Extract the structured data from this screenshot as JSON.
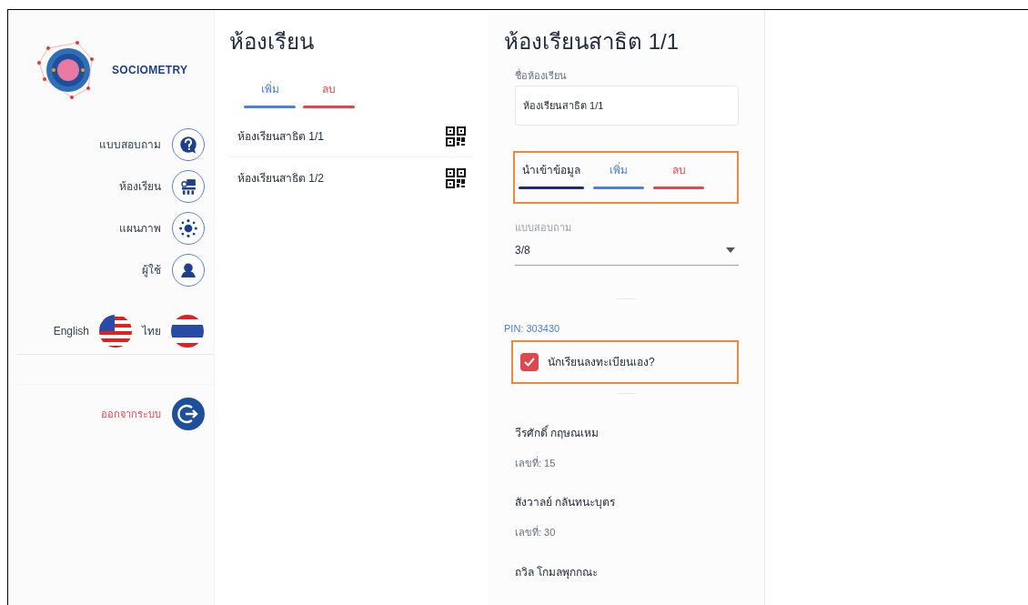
{
  "brand": {
    "name": "SOCIOMETRY"
  },
  "nav": [
    {
      "label": "แบบสอบถาม",
      "kind": "questionnaire"
    },
    {
      "label": "ห้องเรียน",
      "kind": "classroom"
    },
    {
      "label": "แผนภาพ",
      "kind": "diagram"
    },
    {
      "label": "ผู้ใช้",
      "kind": "user"
    }
  ],
  "languages": [
    {
      "label": "English",
      "kind": "us"
    },
    {
      "label": "ไทย",
      "kind": "th"
    }
  ],
  "logout": {
    "label": "ออกจากระบบ"
  },
  "classrooms": {
    "title": "ห้องเรียน",
    "actions": [
      {
        "label": "เพิ่ม",
        "kind": "add"
      },
      {
        "label": "ลบ",
        "kind": "delete"
      }
    ],
    "items": [
      {
        "name": "ห้องเรียนสาธิต 1/1"
      },
      {
        "name": "ห้องเรียนสาธิต 1/2"
      }
    ]
  },
  "detail": {
    "title": "ห้องเรียนสาธิต 1/1",
    "name_field": {
      "label": "ชื่อห้องเรียน",
      "value": "ห้องเรียนสาธิต 1/1"
    },
    "actions_highlighted": true,
    "actions": [
      {
        "label": "นำเข้าข้อมูล",
        "kind": "import"
      },
      {
        "label": "เพิ่ม",
        "kind": "add"
      },
      {
        "label": "ลบ",
        "kind": "delete"
      }
    ],
    "questionnaire": {
      "label": "แบบสอบถาม",
      "value": "3/8"
    },
    "pin": "PIN: 303430",
    "self_register": {
      "label": "นักเรียนลงทะเบียนเอง?",
      "checked": true,
      "highlighted": true
    },
    "students": [
      {
        "name": "วีรศักดิ์ กฤษณเหม",
        "number": "เลขที่: 15"
      },
      {
        "name": "สังวาลย์ กลันทนะบุตร",
        "number": "เลขที่: 30"
      },
      {
        "name": "ถวิล โกมลพุกกณะ"
      }
    ]
  }
}
